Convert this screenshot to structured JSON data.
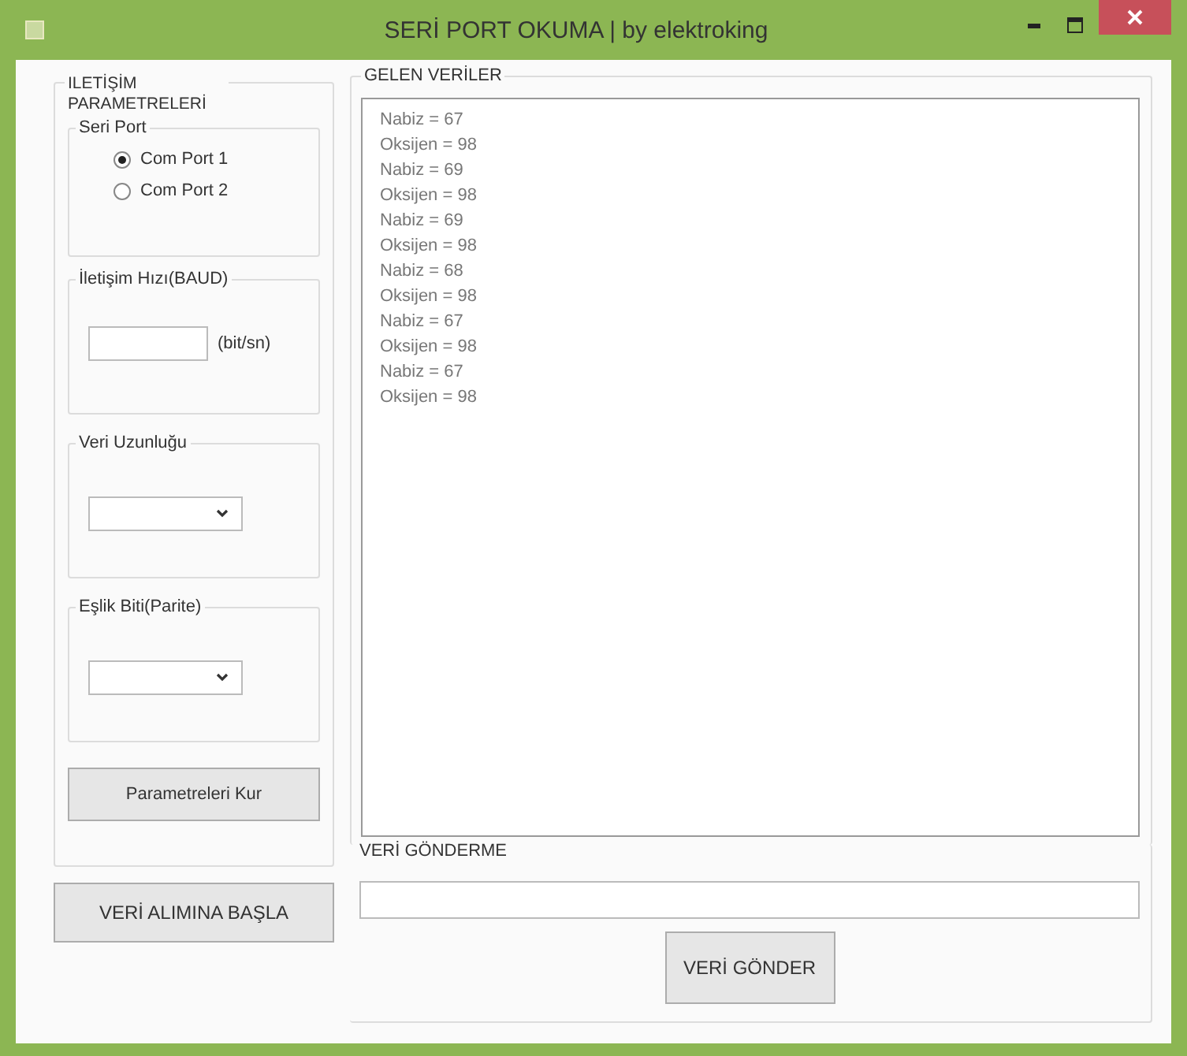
{
  "window": {
    "title": "SERİ PORT OKUMA | by elektroking"
  },
  "parameters": {
    "title": "ILETİŞİM PARAMETRELERİ",
    "serial_port": {
      "title": "Seri Port",
      "options": [
        {
          "label": "Com Port 1",
          "selected": true
        },
        {
          "label": "Com Port 2",
          "selected": false
        }
      ]
    },
    "baud": {
      "title": "İletişim Hızı(BAUD)",
      "unit": "(bit/sn)"
    },
    "data_length": {
      "title": "Veri Uzunluğu"
    },
    "parity": {
      "title": "Eşlik Biti(Parite)"
    },
    "apply_button": "Parametreleri Kur"
  },
  "start_button": "VERİ ALIMINA BAŞLA",
  "received": {
    "title": "GELEN VERİLER",
    "lines": [
      "Nabiz = 67",
      "Oksijen = 98",
      "Nabiz = 69",
      "Oksijen = 98",
      "Nabiz = 69",
      "Oksijen = 98",
      "Nabiz = 68",
      "Oksijen = 98",
      "Nabiz = 67",
      "Oksijen = 98",
      "Nabiz = 67",
      "Oksijen = 98"
    ]
  },
  "send": {
    "title": "VERİ GÖNDERME",
    "button": "VERİ GÖNDER"
  }
}
